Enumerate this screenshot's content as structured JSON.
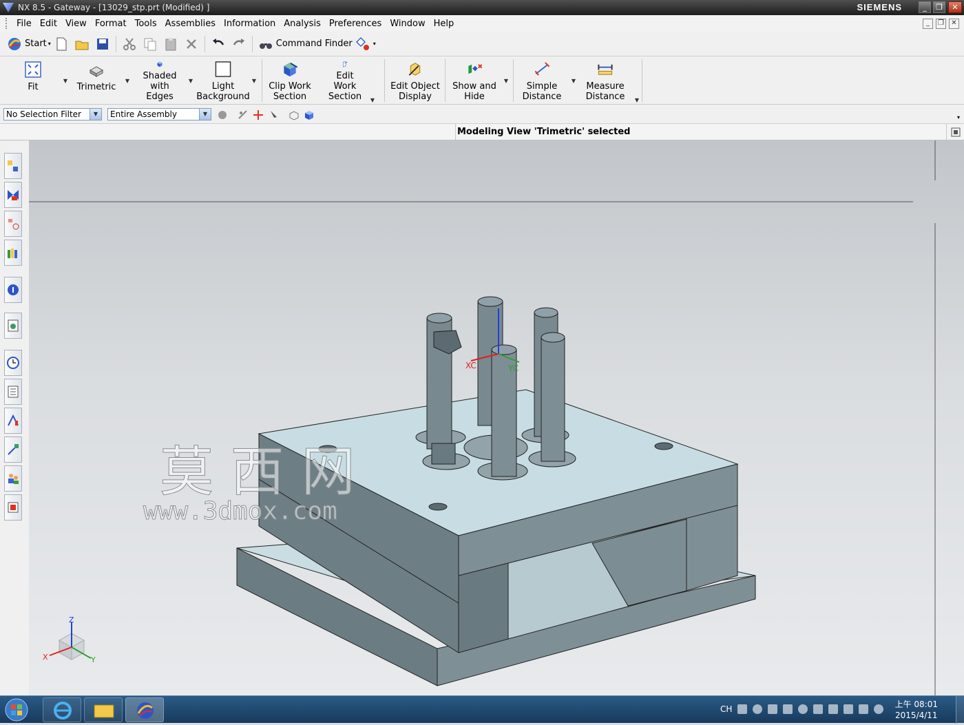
{
  "window": {
    "title": "NX 8.5 - Gateway - [13029_stp.prt (Modified) ]",
    "brand": "SIEMENS"
  },
  "menu": [
    "File",
    "Edit",
    "View",
    "Format",
    "Tools",
    "Assemblies",
    "Information",
    "Analysis",
    "Preferences",
    "Window",
    "Help"
  ],
  "standard_toolbar": {
    "start_label": "Start",
    "command_finder_label": "Command Finder"
  },
  "ribbon": {
    "fit": "Fit",
    "trimetric": "Trimetric",
    "shaded_l1": "Shaded with",
    "shaded_l2": "Edges",
    "light_l1": "Light",
    "light_l2": "Background",
    "clip_l1": "Clip Work",
    "clip_l2": "Section",
    "editwork_l1": "Edit Work",
    "editwork_l2": "Section",
    "editobj_l1": "Edit Object",
    "editobj_l2": "Display",
    "showhide_l1": "Show and",
    "showhide_l2": "Hide",
    "simple_l1": "Simple",
    "simple_l2": "Distance",
    "measure_l1": "Measure",
    "measure_l2": "Distance"
  },
  "selection": {
    "filter": "No Selection Filter",
    "scope": "Entire Assembly"
  },
  "status": {
    "cue": "Modeling View 'Trimetric' selected"
  },
  "viewport": {
    "watermark_cn": "莫 西 网",
    "watermark_url": "www.3dmox.com",
    "wcs_x": "XC",
    "wcs_y": "YC",
    "triad_x": "X",
    "triad_y": "Y",
    "triad_z": "Z"
  },
  "taskbar": {
    "tray_lang": "CH",
    "time": "上午 08:01",
    "date": "2015/4/11"
  },
  "colors": {
    "mold_top": "#c5dde3",
    "mold_side": "#6f7f86",
    "mold_front": "#7e8e95",
    "background": "#dadde0"
  }
}
